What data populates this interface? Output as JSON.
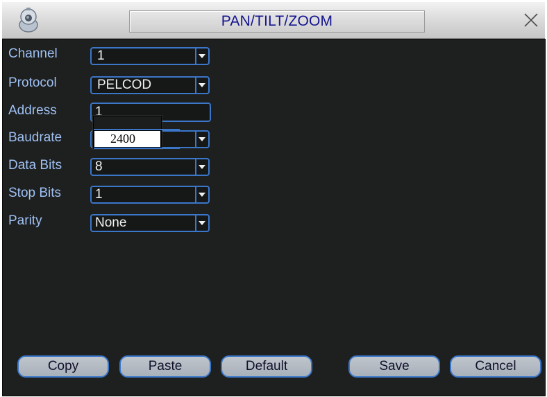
{
  "window": {
    "title": "PAN/TILT/ZOOM"
  },
  "form": {
    "channel": {
      "label": "Channel",
      "value": "1"
    },
    "protocol": {
      "label": "Protocol",
      "value": "PELCOD"
    },
    "address": {
      "label": "Address",
      "value": "1"
    },
    "baudrate": {
      "label": "Baudrate",
      "value": "2400"
    },
    "data_bits": {
      "label": "Data Bits",
      "value": "8"
    },
    "stop_bits": {
      "label": "Stop Bits",
      "value": "1"
    },
    "parity": {
      "label": "Parity",
      "value": "None"
    }
  },
  "buttons": {
    "copy": "Copy",
    "paste": "Paste",
    "default": "Default",
    "save": "Save",
    "cancel": "Cancel"
  },
  "icons": {
    "logo": "ptz-camera-icon",
    "close": "close-icon",
    "dropdown": "chevron-down-icon"
  },
  "colors": {
    "panel_bg": "#1e1f1f",
    "label_text": "#9fc1f3",
    "field_border": "#3b77c9",
    "title_text": "#14148f"
  }
}
